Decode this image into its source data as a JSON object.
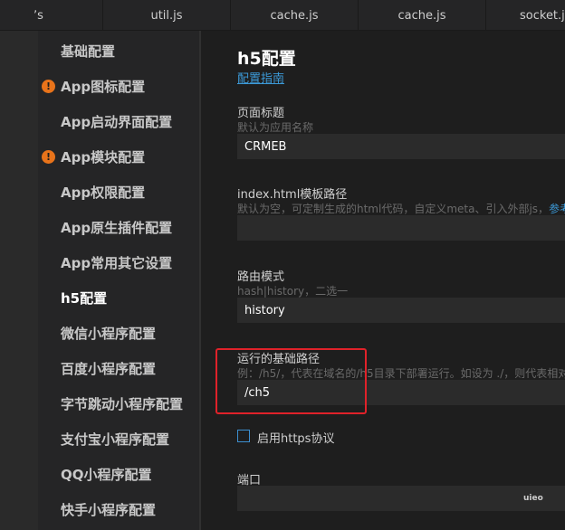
{
  "tabs": [
    {
      "label": "ʼs"
    },
    {
      "label": "util.js"
    },
    {
      "label": "cache.js"
    },
    {
      "label": "cache.js"
    },
    {
      "label": "socket.js"
    }
  ],
  "nav": {
    "items": [
      {
        "label": "基础配置",
        "warning": false,
        "active": false
      },
      {
        "label": "App图标配置",
        "warning": true,
        "active": false
      },
      {
        "label": "App启动界面配置",
        "warning": false,
        "active": false
      },
      {
        "label": "App模块配置",
        "warning": true,
        "active": false
      },
      {
        "label": "App权限配置",
        "warning": false,
        "active": false
      },
      {
        "label": "App原生插件配置",
        "warning": false,
        "active": false
      },
      {
        "label": "App常用其它设置",
        "warning": false,
        "active": false
      },
      {
        "label": "h5配置",
        "warning": false,
        "active": true
      },
      {
        "label": "微信小程序配置",
        "warning": false,
        "active": false
      },
      {
        "label": "百度小程序配置",
        "warning": false,
        "active": false
      },
      {
        "label": "字节跳动小程序配置",
        "warning": false,
        "active": false
      },
      {
        "label": "支付宝小程序配置",
        "warning": false,
        "active": false
      },
      {
        "label": "QQ小程序配置",
        "warning": false,
        "active": false
      },
      {
        "label": "快手小程序配置",
        "warning": false,
        "active": false
      }
    ],
    "warning_glyph": "!"
  },
  "content": {
    "title": "h5配置",
    "guide_link": "配置指南",
    "page_title_field": {
      "label": "页面标题",
      "hint": "默认为应用名称",
      "value": "CRMEB"
    },
    "template_field": {
      "label": "index.html模板路径",
      "hint": "默认为空，可定制生成的html代码，自定义meta、引入外部js，",
      "hint_link": "参考",
      "value": ""
    },
    "router_field": {
      "label": "路由模式",
      "hint": "hash|history，二选一",
      "value": "history"
    },
    "base_path_field": {
      "label": "运行的基础路径",
      "hint": "例：/h5/，代表在域名的/h5目录下部署运行。如设为 ./，则代表相对",
      "value": "/ch5"
    },
    "https_checkbox": {
      "label": "启用https协议",
      "checked": false
    },
    "port_field": {
      "label": "端口",
      "value": ""
    }
  },
  "watermark": "uieo",
  "colors": {
    "accent": "#3c9ad8",
    "warning": "#e8731a",
    "highlight": "#e0222a"
  }
}
